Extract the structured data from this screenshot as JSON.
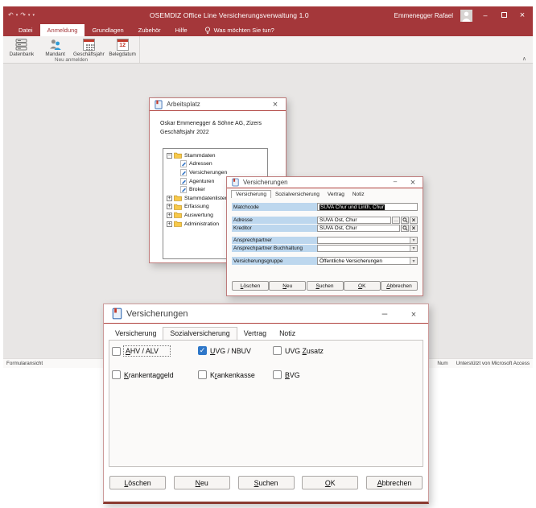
{
  "colors": {
    "accent_red": "#A4373A",
    "label_blue": "#BDD7EE",
    "check_blue": "#2E77C9",
    "window_border": "#BE7B7B"
  },
  "app": {
    "title": "OSEMDIZ Office Line Versicherungsverwaltung 1.0",
    "user_name": "Emmenegger Rafael",
    "menu_tabs": [
      {
        "label": "Datei"
      },
      {
        "label": "Anmeldung"
      },
      {
        "label": "Grundlagen"
      },
      {
        "label": "Zubehör"
      },
      {
        "label": "Hilfe"
      }
    ],
    "active_menu_tab": "Anmeldung",
    "tell_me": "Was möchten Sie tun?",
    "ribbon": {
      "group_label": "Neu anmelden",
      "buttons": [
        {
          "label": "Datenbank"
        },
        {
          "label": "Mandant"
        },
        {
          "label": "Geschäftsjahr"
        },
        {
          "label": "Belegdatum"
        }
      ],
      "calendar_day": "12"
    },
    "statusbar": {
      "view": "Formularansicht",
      "num": "Num",
      "brand": "Unterstützt von Microsoft Access"
    }
  },
  "arbeitsplatz": {
    "title": "Arbeitsplatz",
    "company": "Oskar Emmenegger & Söhne AG, Zizers",
    "fiscal_year": "Geschäftsjahr 2022",
    "tree": [
      {
        "label": "Stammdaten",
        "type": "folder",
        "state": "expanded"
      },
      {
        "label": "Adressen",
        "type": "form"
      },
      {
        "label": "Versicherungen",
        "type": "form"
      },
      {
        "label": "Agenturen",
        "type": "form"
      },
      {
        "label": "Broker",
        "type": "form"
      },
      {
        "label": "Stammdatenlisten",
        "type": "folder",
        "state": "collapsed"
      },
      {
        "label": "Erfassung",
        "type": "folder",
        "state": "collapsed"
      },
      {
        "label": "Auswertung",
        "type": "folder",
        "state": "collapsed"
      },
      {
        "label": "Administration",
        "type": "folder",
        "state": "collapsed"
      }
    ]
  },
  "versicherung_dialog": {
    "title": "Versicherungen",
    "tabs": [
      {
        "label": "Versicherung"
      },
      {
        "label": "Sozialversicherung"
      },
      {
        "label": "Vertrag"
      },
      {
        "label": "Notiz"
      }
    ],
    "active_tab": "Versicherung",
    "matchcode_label": "Matchcode",
    "matchcode_value": "SUVA Chur und Linth, Chur",
    "adresse_label": "Adresse",
    "adresse_value": "SUVA Ost, Chur",
    "kreditor_label": "Kreditor",
    "kreditor_value": "SUVA Ost, Chur",
    "ansprechpartner_label": "Ansprechpartner",
    "ansprechpartner_value": "",
    "ansprechpartner_buch_label": "Ansprechpartner Buchhaltung",
    "ansprechpartner_buch_value": "",
    "gruppe_label": "Versicherungsgruppe",
    "gruppe_value": "Öffentliche Versicherungen",
    "browse_button": "…",
    "buttons": [
      {
        "label": "Löschen"
      },
      {
        "label": "Neu"
      },
      {
        "label": "Suchen"
      },
      {
        "label": "OK"
      },
      {
        "label": "Abbrechen"
      }
    ]
  },
  "sozial_dialog": {
    "title": "Versicherungen",
    "tabs": [
      {
        "label": "Versicherung"
      },
      {
        "label": "Sozialversicherung"
      },
      {
        "label": "Vertrag"
      },
      {
        "label": "Notiz"
      }
    ],
    "active_tab": "Sozialversicherung",
    "checkboxes": [
      {
        "label": "AHV / ALV",
        "checked": false
      },
      {
        "label": "UVG / NBUV",
        "checked": true
      },
      {
        "label": "UVG Zusatz",
        "checked": false
      },
      {
        "label": "Krankentaggeld",
        "checked": false
      },
      {
        "label": "Krankenkasse",
        "checked": false
      },
      {
        "label": "BVG",
        "checked": false
      }
    ],
    "buttons": [
      {
        "label": "Löschen"
      },
      {
        "label": "Neu"
      },
      {
        "label": "Suchen"
      },
      {
        "label": "OK"
      },
      {
        "label": "Abbrechen"
      }
    ]
  }
}
